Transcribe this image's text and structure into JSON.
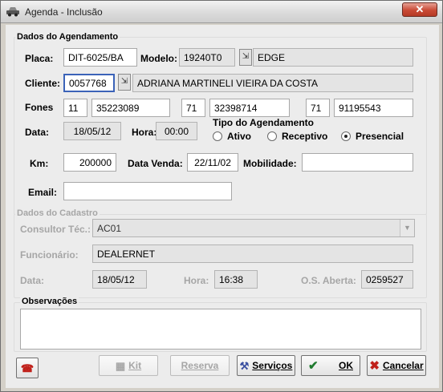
{
  "window": {
    "title": "Agenda - Inclusão",
    "close_label": "✕"
  },
  "agendamento": {
    "section_title": "Dados do Agendamento",
    "placa": {
      "label": "Placa:",
      "value": "DIT-6025/BA"
    },
    "modelo": {
      "label": "Modelo:",
      "code": "19240T0",
      "name": "EDGE"
    },
    "cliente": {
      "label": "Cliente:",
      "code": "0057768",
      "name": "ADRIANA MARTINELI VIEIRA DA COSTA"
    },
    "fones": {
      "label": "Fones",
      "phones": [
        {
          "ddd": "11",
          "number": "35223089"
        },
        {
          "ddd": "71",
          "number": "32398714"
        },
        {
          "ddd": "71",
          "number": "91195543"
        }
      ]
    },
    "data": {
      "label": "Data:",
      "value": "18/05/12"
    },
    "hora": {
      "label": "Hora:",
      "value": "00:00"
    },
    "tipo": {
      "label": "Tipo do Agendamento",
      "options": [
        "Ativo",
        "Receptivo",
        "Presencial"
      ],
      "selected": "Presencial"
    },
    "km": {
      "label": "Km:",
      "value": "200000"
    },
    "data_venda": {
      "label": "Data Venda:",
      "value": "22/11/02"
    },
    "mobilidade": {
      "label": "Mobilidade:",
      "value": ""
    },
    "email": {
      "label": "Email:",
      "value": ""
    }
  },
  "cadastro": {
    "section_title": "Dados do Cadastro",
    "consultor": {
      "label": "Consultor Téc.:",
      "value": "AC01"
    },
    "funcionario": {
      "label": "Funcionário:",
      "value": "DEALERNET"
    },
    "data": {
      "label": "Data:",
      "value": "18/05/12"
    },
    "hora": {
      "label": "Hora:",
      "value": "16:38"
    },
    "os_aberta": {
      "label": "O.S. Aberta:",
      "value": "0259527"
    }
  },
  "observacoes": {
    "section_title": "Observações",
    "value": ""
  },
  "buttons": {
    "kit": "Kit",
    "reserva": "Reserva",
    "servicos": "Serviços",
    "ok": "OK",
    "cancelar": "Cancelar"
  },
  "colors": {
    "accent_focus": "#3b63b8",
    "cancel_x": "#c0201a",
    "ok_check": "#1f7a2e"
  }
}
